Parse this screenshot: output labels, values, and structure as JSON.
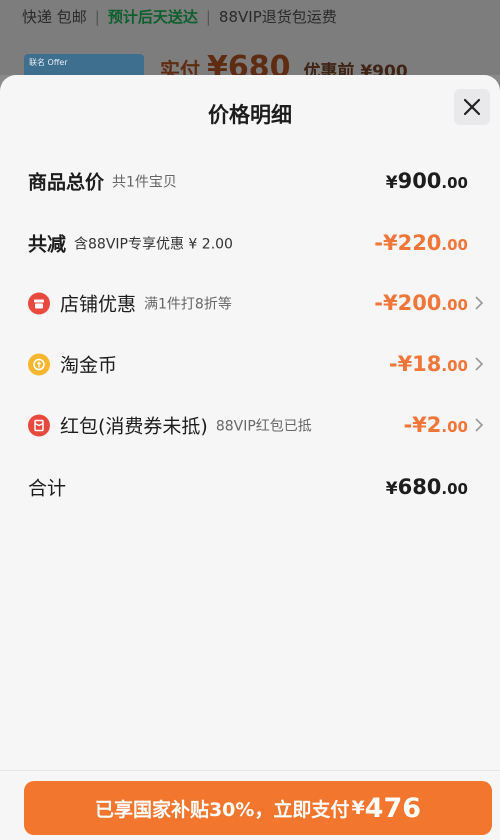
{
  "background": {
    "shipping": "快递 包邮",
    "delivery": "预计后天送达",
    "vip_return": "88VIP退货包运费",
    "card_tag": "联名 Offer",
    "paid_label": "实付",
    "paid_amount": "¥680",
    "pre_discount": "优惠前 ¥900"
  },
  "sheet": {
    "title": "价格明细",
    "close_icon": "close-icon"
  },
  "rows": {
    "total": {
      "label": "商品总价",
      "sub": "共1件宝贝",
      "amount_main": "900",
      "amount_cents": ".00"
    },
    "reduction": {
      "label": "共减",
      "sub": "含88VIP专享优惠 ¥ 2.00",
      "amount_main": "-¥220",
      "amount_cents": ".00"
    },
    "store": {
      "label": "店铺优惠",
      "sub": "满1件打8折等",
      "amount_main": "-¥200",
      "amount_cents": ".00",
      "icon": "store-icon"
    },
    "coins": {
      "label": "淘金币",
      "sub": "",
      "amount_main": "-¥18",
      "amount_cents": ".00",
      "icon": "coin-icon"
    },
    "redpacket": {
      "label": "红包(消费券未抵)",
      "sub": "88VIP红包已抵",
      "amount_main": "-¥2",
      "amount_cents": ".00",
      "icon": "red-packet-icon"
    },
    "sum": {
      "label": "合计",
      "amount_main": "680",
      "amount_cents": ".00"
    }
  },
  "pay_button": {
    "text": "已享国家补贴30%，立即支付",
    "currency": "¥",
    "amount": "476"
  },
  "colors": {
    "accent": "#f2762e",
    "discount": "#f0763a",
    "sheet_bg": "#f6f6f7"
  }
}
